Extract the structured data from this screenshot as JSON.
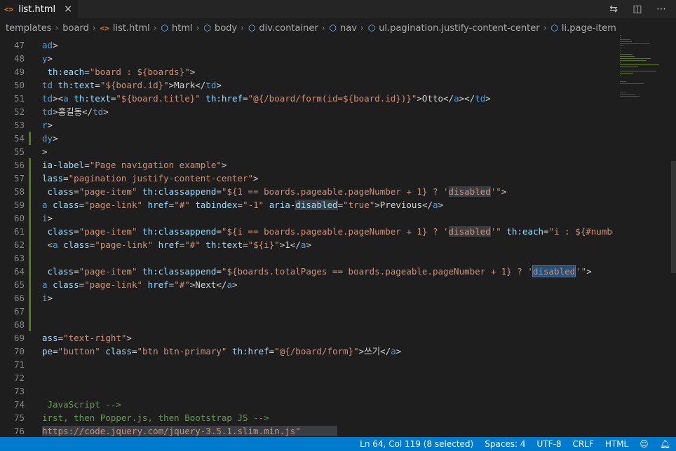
{
  "tab": {
    "icon": "html-file-icon",
    "title": "list.html",
    "close": "×"
  },
  "actions": [
    {
      "name": "open-changes-icon",
      "glyph": "⇆"
    },
    {
      "name": "split-editor-icon",
      "glyph": "◫"
    },
    {
      "name": "more-actions-icon",
      "glyph": "⋯"
    }
  ],
  "breadcrumb": [
    "templates",
    "board",
    "list.html",
    "html",
    "body",
    "div.container",
    "nav",
    "ul.pagination.justify-content-center",
    "li.page-item"
  ],
  "editor": {
    "lines": [
      {
        "n": "47",
        "mod": false,
        "segs": [
          [
            "t-tag",
            "ad"
          ],
          [
            "t-txt",
            ">"
          ]
        ]
      },
      {
        "n": "48",
        "mod": false,
        "segs": [
          [
            "t-tag",
            "y"
          ],
          [
            "t-txt",
            ">"
          ]
        ]
      },
      {
        "n": "49",
        "mod": false,
        "segs": [
          [
            "t-txt",
            " "
          ],
          [
            "t-attr",
            "th:each"
          ],
          [
            "t-txt",
            "="
          ],
          [
            "t-str",
            "\"board : ${boards}\""
          ],
          [
            "t-txt",
            ">"
          ]
        ]
      },
      {
        "n": "50",
        "mod": false,
        "segs": [
          [
            "t-tag",
            "td"
          ],
          [
            "t-txt",
            " "
          ],
          [
            "t-attr",
            "th:text"
          ],
          [
            "t-txt",
            "="
          ],
          [
            "t-str",
            "\"${board.id}\""
          ],
          [
            "t-txt",
            ">Mark</"
          ],
          [
            "t-tag",
            "td"
          ],
          [
            "t-txt",
            ">"
          ]
        ]
      },
      {
        "n": "51",
        "mod": false,
        "segs": [
          [
            "t-tag",
            "td"
          ],
          [
            "t-txt",
            "><"
          ],
          [
            "t-tag",
            "a"
          ],
          [
            "t-txt",
            " "
          ],
          [
            "t-attr",
            "th:text"
          ],
          [
            "t-txt",
            "="
          ],
          [
            "t-str",
            "\"${board.title}\""
          ],
          [
            "t-txt",
            " "
          ],
          [
            "t-attr",
            "th:href"
          ],
          [
            "t-txt",
            "="
          ],
          [
            "t-str",
            "\"@{/board/form(id=${board.id})}\""
          ],
          [
            "t-txt",
            ">Otto</"
          ],
          [
            "t-tag",
            "a"
          ],
          [
            "t-txt",
            "></"
          ],
          [
            "t-tag",
            "td"
          ],
          [
            "t-txt",
            ">"
          ]
        ]
      },
      {
        "n": "52",
        "mod": false,
        "segs": [
          [
            "t-tag",
            "td"
          ],
          [
            "t-txt",
            ">홍길동</"
          ],
          [
            "t-tag",
            "td"
          ],
          [
            "t-txt",
            ">"
          ]
        ]
      },
      {
        "n": "53",
        "mod": false,
        "segs": [
          [
            "t-tag",
            "r"
          ],
          [
            "t-txt",
            ">"
          ]
        ]
      },
      {
        "n": "54",
        "mod": true,
        "segs": [
          [
            "t-tag",
            "dy"
          ],
          [
            "t-txt",
            ">"
          ]
        ]
      },
      {
        "n": "55",
        "mod": false,
        "segs": [
          [
            "t-txt",
            ">"
          ]
        ]
      },
      {
        "n": "56",
        "mod": true,
        "segs": [
          [
            "t-attr",
            "ia-label"
          ],
          [
            "t-txt",
            "="
          ],
          [
            "t-str",
            "\"Page navigation example\""
          ],
          [
            "t-txt",
            ">"
          ]
        ]
      },
      {
        "n": "57",
        "mod": true,
        "segs": [
          [
            "t-attr",
            "lass"
          ],
          [
            "t-txt",
            "="
          ],
          [
            "t-str",
            "\"pagination justify-content-center\""
          ],
          [
            "t-txt",
            ">"
          ]
        ]
      },
      {
        "n": "58",
        "mod": true,
        "segs": [
          [
            "t-txt",
            " "
          ],
          [
            "t-attr",
            "class"
          ],
          [
            "t-txt",
            "="
          ],
          [
            "t-str",
            "\"page-item\""
          ],
          [
            "t-txt",
            " "
          ],
          [
            "t-attr",
            "th:classappend"
          ],
          [
            "t-txt",
            "="
          ],
          [
            "t-str",
            "\"${1 == boards.pageable.pageNumber + 1} ? '"
          ],
          [
            "t-str hl",
            "disabled"
          ],
          [
            "t-str",
            "'\""
          ],
          [
            "t-txt",
            ">"
          ]
        ]
      },
      {
        "n": "59",
        "mod": true,
        "segs": [
          [
            "t-tag",
            "a"
          ],
          [
            "t-txt",
            " "
          ],
          [
            "t-attr",
            "class"
          ],
          [
            "t-txt",
            "="
          ],
          [
            "t-str",
            "\"page-link\""
          ],
          [
            "t-txt",
            " "
          ],
          [
            "t-attr",
            "href"
          ],
          [
            "t-txt",
            "="
          ],
          [
            "t-str",
            "\"#\""
          ],
          [
            "t-txt",
            " "
          ],
          [
            "t-attr",
            "tabindex"
          ],
          [
            "t-txt",
            "="
          ],
          [
            "t-str",
            "\"-1\""
          ],
          [
            "t-txt",
            " "
          ],
          [
            "t-attr",
            "aria-"
          ],
          [
            "t-attr hl",
            "disabled"
          ],
          [
            "t-txt",
            "="
          ],
          [
            "t-str",
            "\"true\""
          ],
          [
            "t-txt",
            ">Previous</"
          ],
          [
            "t-tag",
            "a"
          ],
          [
            "t-txt",
            ">"
          ]
        ]
      },
      {
        "n": "60",
        "mod": true,
        "segs": [
          [
            "t-tag",
            "i"
          ],
          [
            "t-txt",
            ">"
          ]
        ]
      },
      {
        "n": "61",
        "mod": true,
        "segs": [
          [
            "t-txt",
            " "
          ],
          [
            "t-attr",
            "class"
          ],
          [
            "t-txt",
            "="
          ],
          [
            "t-str",
            "\"page-item\""
          ],
          [
            "t-txt",
            " "
          ],
          [
            "t-attr",
            "th:classappend"
          ],
          [
            "t-txt",
            "="
          ],
          [
            "t-str",
            "\"${i == boards.pageable.pageNumber + 1} ? '"
          ],
          [
            "t-str hl",
            "disabled"
          ],
          [
            "t-str",
            "'\""
          ],
          [
            "t-txt",
            " "
          ],
          [
            "t-attr",
            "th:each"
          ],
          [
            "t-txt",
            "="
          ],
          [
            "t-str",
            "\"i : ${#numbers"
          ]
        ]
      },
      {
        "n": "62",
        "mod": true,
        "segs": [
          [
            "t-txt",
            " <"
          ],
          [
            "t-tag",
            "a"
          ],
          [
            "t-txt",
            " "
          ],
          [
            "t-attr",
            "class"
          ],
          [
            "t-txt",
            "="
          ],
          [
            "t-str",
            "\"page-link\""
          ],
          [
            "t-txt",
            " "
          ],
          [
            "t-attr",
            "href"
          ],
          [
            "t-txt",
            "="
          ],
          [
            "t-str",
            "\"#\""
          ],
          [
            "t-txt",
            " "
          ],
          [
            "t-attr",
            "th:text"
          ],
          [
            "t-txt",
            "="
          ],
          [
            "t-str",
            "\"${i}\""
          ],
          [
            "t-txt",
            ">1</"
          ],
          [
            "t-tag",
            "a"
          ],
          [
            "t-txt",
            ">"
          ]
        ]
      },
      {
        "n": "63",
        "mod": true,
        "segs": []
      },
      {
        "n": "64",
        "mod": true,
        "segs": [
          [
            "t-txt",
            " "
          ],
          [
            "t-attr",
            "class"
          ],
          [
            "t-txt",
            "="
          ],
          [
            "t-str",
            "\"page-item\""
          ],
          [
            "t-txt",
            " "
          ],
          [
            "t-attr",
            "th:classappend"
          ],
          [
            "t-txt",
            "="
          ],
          [
            "t-str",
            "\"${boards.totalPages == boards.pageable.pageNumber + 1} ? '"
          ],
          [
            "t-str sel",
            "disabled"
          ],
          [
            "cursor",
            ""
          ],
          [
            "t-str",
            "'\""
          ],
          [
            "t-txt",
            ">"
          ]
        ]
      },
      {
        "n": "65",
        "mod": true,
        "segs": [
          [
            "t-tag",
            "a"
          ],
          [
            "t-txt",
            " "
          ],
          [
            "t-attr",
            "class"
          ],
          [
            "t-txt",
            "="
          ],
          [
            "t-str",
            "\"page-link\""
          ],
          [
            "t-txt",
            " "
          ],
          [
            "t-attr",
            "href"
          ],
          [
            "t-txt",
            "="
          ],
          [
            "t-str",
            "\"#\""
          ],
          [
            "t-txt",
            ">Next</"
          ],
          [
            "t-tag",
            "a"
          ],
          [
            "t-txt",
            ">"
          ]
        ]
      },
      {
        "n": "66",
        "mod": true,
        "segs": [
          [
            "t-tag",
            "i"
          ],
          [
            "t-txt",
            ">"
          ]
        ]
      },
      {
        "n": "67",
        "mod": true,
        "segs": []
      },
      {
        "n": "68",
        "mod": true,
        "segs": []
      },
      {
        "n": "69",
        "mod": false,
        "segs": [
          [
            "t-attr",
            "ass"
          ],
          [
            "t-txt",
            "="
          ],
          [
            "t-str",
            "\"text-right\""
          ],
          [
            "t-txt",
            ">"
          ]
        ]
      },
      {
        "n": "70",
        "mod": false,
        "segs": [
          [
            "t-attr",
            "pe"
          ],
          [
            "t-txt",
            "="
          ],
          [
            "t-str",
            "\"button\""
          ],
          [
            "t-txt",
            " "
          ],
          [
            "t-attr",
            "class"
          ],
          [
            "t-txt",
            "="
          ],
          [
            "t-str",
            "\"btn btn-primary\""
          ],
          [
            "t-txt",
            " "
          ],
          [
            "t-attr",
            "th:href"
          ],
          [
            "t-txt",
            "="
          ],
          [
            "t-str",
            "\"@{/board/form}\""
          ],
          [
            "t-txt",
            ">쓰기</"
          ],
          [
            "t-tag",
            "a"
          ],
          [
            "t-txt",
            ">"
          ]
        ]
      },
      {
        "n": "71",
        "mod": false,
        "segs": []
      },
      {
        "n": "72",
        "mod": false,
        "segs": []
      },
      {
        "n": "73",
        "mod": false,
        "segs": []
      },
      {
        "n": "74",
        "mod": false,
        "segs": [
          [
            "t-cmt",
            " JavaScript -->"
          ]
        ]
      },
      {
        "n": "75",
        "mod": false,
        "segs": [
          [
            "t-cmt",
            "irst, then Popper.js, then Bootstrap JS -->"
          ]
        ]
      },
      {
        "n": "76",
        "mod": false,
        "segs": [
          [
            "t-url url-row",
            "https://code.jquery.com/jquery-3.5.1.slim.min.js\"       "
          ]
        ]
      }
    ]
  },
  "status": {
    "position": "Ln 64, Col 119 (8 selected)",
    "spaces": "Spaces: 4",
    "encoding": "UTF-8",
    "eol": "CRLF",
    "language": "HTML",
    "feedback_icon": "person-feedback-icon",
    "notifications_icon": "bell-icon"
  },
  "colors": {
    "statusbar": "#007acc",
    "editor_bg": "#1e1e1e",
    "modified_gutter": "#587c0c"
  }
}
